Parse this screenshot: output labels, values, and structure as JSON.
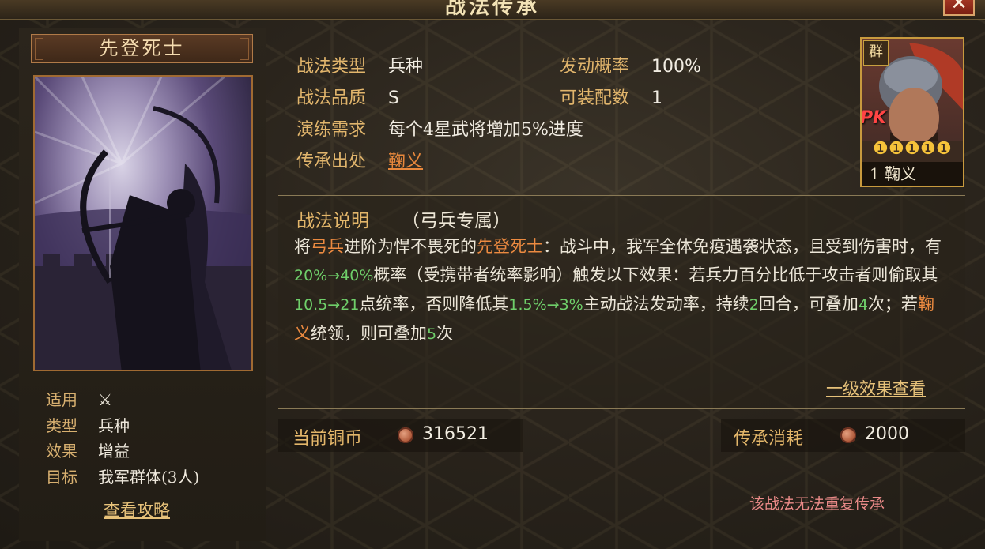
{
  "window": {
    "title": "战法传承",
    "close_label": "✕"
  },
  "skill": {
    "name": "先登死士",
    "attributes": [
      {
        "label": "适用",
        "value": "⚔"
      },
      {
        "label": "类型",
        "value": "兵种"
      },
      {
        "label": "效果",
        "value": "增益"
      },
      {
        "label": "目标",
        "value": "我军群体(3人)"
      }
    ],
    "guide_link": "查看攻略"
  },
  "info": {
    "type_label": "战法类型",
    "type_value": "兵种",
    "rate_label": "发动概率",
    "rate_value": "100%",
    "quality_label": "战法品质",
    "quality_value": "S",
    "slots_label": "可装配数",
    "slots_value": "1",
    "training_label": "演练需求",
    "training_value": "每个4星武将增加5%进度",
    "source_label": "传承出处",
    "source_value": "鞠义"
  },
  "hero": {
    "faction": "群",
    "pk": "PK",
    "name": "1 鞠义",
    "stars": 5,
    "star_color": "#f6c33a"
  },
  "description": {
    "title": "战法说明",
    "subtitle": "（弓兵专属）",
    "segments": [
      {
        "text": "将",
        "style": "n"
      },
      {
        "text": "弓兵",
        "style": "o"
      },
      {
        "text": "进阶为悍不畏死的",
        "style": "n"
      },
      {
        "text": "先登死士",
        "style": "o"
      },
      {
        "text": "：战斗中，我军全体免疫遇袭状态，且受到伤害时，有",
        "style": "n"
      },
      {
        "text": "20%→40%",
        "style": "g"
      },
      {
        "text": "概率（受携带者统率影响）触发以下效果：若兵力百分比低于攻击者则偷取其",
        "style": "n"
      },
      {
        "text": "10.5→21",
        "style": "g"
      },
      {
        "text": "点统率，否则降低其",
        "style": "n"
      },
      {
        "text": "1.5%→3%",
        "style": "g"
      },
      {
        "text": "主动战法发动率，持续",
        "style": "n"
      },
      {
        "text": "2",
        "style": "g"
      },
      {
        "text": "回合，可叠加",
        "style": "n"
      },
      {
        "text": "4",
        "style": "g"
      },
      {
        "text": "次；若",
        "style": "n"
      },
      {
        "text": "鞠义",
        "style": "o"
      },
      {
        "text": "统领，则可叠加",
        "style": "n"
      },
      {
        "text": "5",
        "style": "g"
      },
      {
        "text": "次",
        "style": "n"
      }
    ],
    "level_link": "一级效果查看"
  },
  "coins": {
    "current_label": "当前铜币",
    "current_value": "316521",
    "cost_label": "传承消耗",
    "cost_value": "2000"
  },
  "warning": "该战法无法重复传承",
  "colors": {
    "orange": "#ec8a40",
    "green": "#6fcf6a",
    "gold": "#e3b66a"
  }
}
